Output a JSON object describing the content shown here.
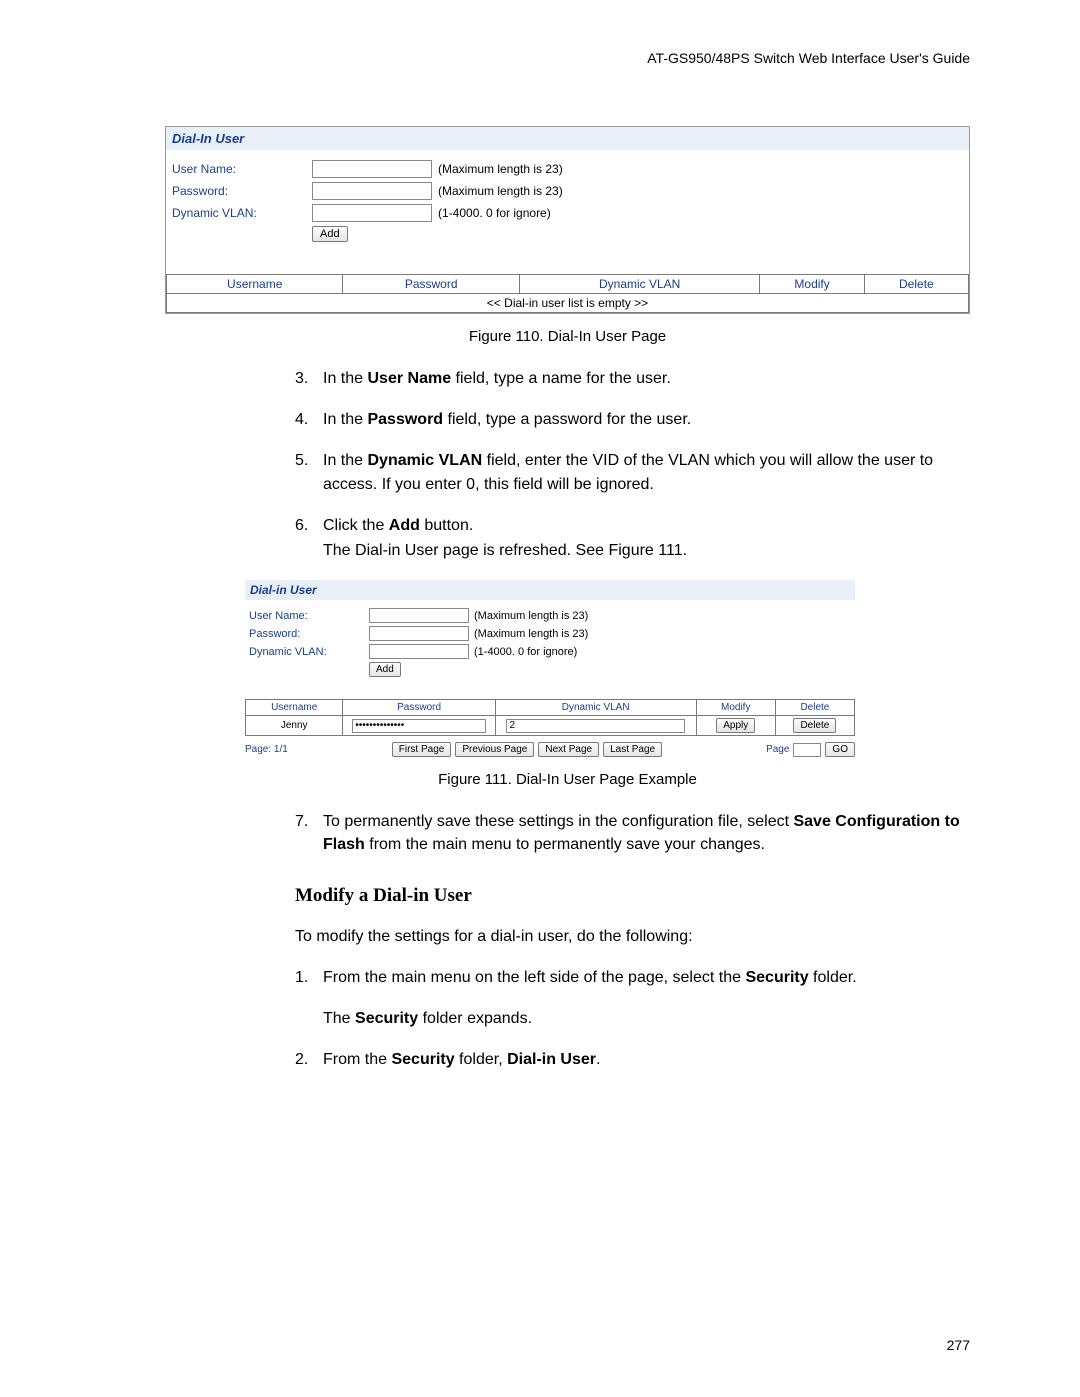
{
  "header": {
    "guide": "AT-GS950/48PS Switch Web Interface User's Guide"
  },
  "figure1": {
    "panel_title": "Dial-In User",
    "rows": {
      "username": {
        "label": "User Name:",
        "hint": "(Maximum length is 23)"
      },
      "password": {
        "label": "Password:",
        "hint": "(Maximum length is 23)"
      },
      "vlan": {
        "label": "Dynamic VLAN:",
        "hint": "(1-4000. 0 for ignore)"
      }
    },
    "add_btn": "Add",
    "table_headers": [
      "Username",
      "Password",
      "Dynamic VLAN",
      "Modify",
      "Delete"
    ],
    "empty_msg": "<< Dial-in user list is empty >>"
  },
  "caption1": "Figure 110. Dial-In User Page",
  "steps_a": {
    "s3": {
      "num": "3.",
      "pre": "In the ",
      "bold": "User Name",
      "post": " field, type a name for the user."
    },
    "s4": {
      "num": "4.",
      "pre": "In the ",
      "bold": "Password",
      "post": " field, type a password for the user."
    },
    "s5": {
      "num": "5.",
      "pre": "In the ",
      "bold": "Dynamic VLAN",
      "post": " field, enter the VID of the VLAN which you will allow the user to access. If you enter 0, this field will be ignored."
    },
    "s6": {
      "num": "6.",
      "pre": "Click the ",
      "bold": "Add",
      "post": " button.",
      "sub": "The Dial-in User page is refreshed. See Figure 111."
    }
  },
  "figure2": {
    "panel_title": "Dial-in User",
    "rows": {
      "username": {
        "label": "User Name:",
        "hint": "(Maximum length is 23)"
      },
      "password": {
        "label": "Password:",
        "hint": "(Maximum length is 23)"
      },
      "vlan": {
        "label": "Dynamic VLAN:",
        "hint": "(1-4000. 0 for ignore)"
      }
    },
    "add_btn": "Add",
    "table_headers": [
      "Username",
      "Password",
      "Dynamic VLAN",
      "Modify",
      "Delete"
    ],
    "row1": {
      "username": "Jenny",
      "password": "••••••••••••••",
      "vlan": "2",
      "modify": "Apply",
      "delete": "Delete"
    },
    "pager": {
      "page_label": "Page: 1/1",
      "first": "First Page",
      "prev": "Previous Page",
      "next": "Next Page",
      "last": "Last Page",
      "page_word": "Page",
      "go": "GO"
    }
  },
  "caption2": "Figure 111. Dial-In User Page Example",
  "steps_b": {
    "s7": {
      "num": "7.",
      "pre": "To permanently save these settings in the configuration file, select ",
      "bold": "Save Configuration to Flash",
      "post": " from the main menu to permanently save your changes."
    }
  },
  "section_heading": "Modify a Dial-in User",
  "para_intro": "To modify the settings for a dial-in user, do the following:",
  "steps_c": {
    "s1": {
      "num": "1.",
      "pre": "From the main menu on the left side of the page, select the ",
      "bold": "Security",
      "post": " folder."
    },
    "s1_sub_pre": "The ",
    "s1_sub_bold": "Security",
    "s1_sub_post": " folder expands.",
    "s2": {
      "num": "2.",
      "pre": "From the ",
      "bold1": "Security",
      "mid": " folder, ",
      "bold2": "Dial-in User",
      "post": "."
    }
  },
  "page_number": "277"
}
